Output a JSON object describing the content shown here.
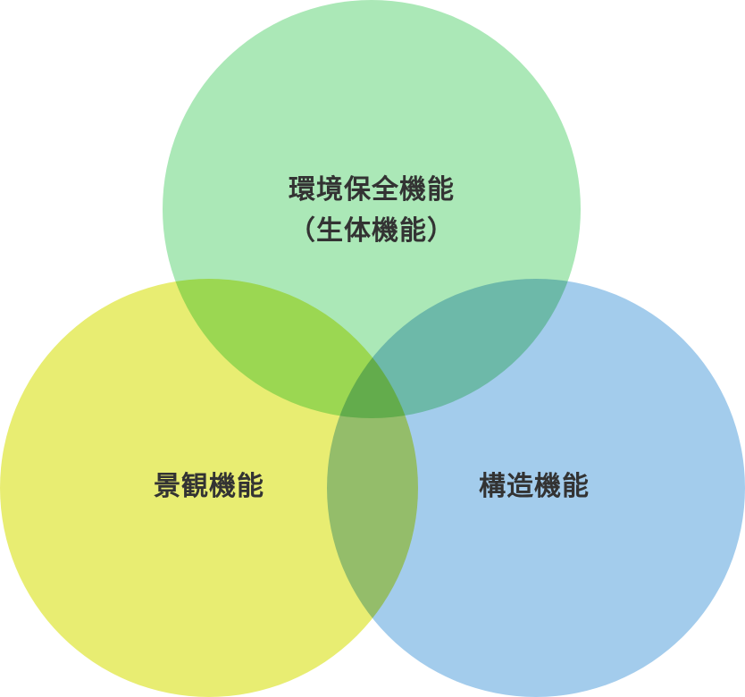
{
  "diagram": {
    "type": "venn",
    "circles": [
      {
        "id": "top",
        "line1": "環境保全機能",
        "line2": "（生体機能）",
        "color": "#abe8b7"
      },
      {
        "id": "left",
        "line1": "景観機能",
        "color": "#e8ed72"
      },
      {
        "id": "right",
        "line1": "構造機能",
        "color": "#a3ccec"
      }
    ],
    "text_color": "#333333"
  }
}
